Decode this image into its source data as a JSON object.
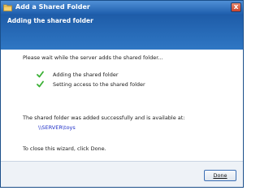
{
  "window": {
    "title": "Add a Shared Folder",
    "close_label": "x"
  },
  "banner": {
    "title": "Adding the shared folder"
  },
  "main": {
    "wait_message": "Please wait while the server adds the shared folder...",
    "steps": [
      {
        "label": "Adding the shared folder",
        "status": "complete",
        "icon": "checkmark-icon"
      },
      {
        "label": "Setting access to the shared folder",
        "status": "complete",
        "icon": "checkmark-icon"
      }
    ],
    "success_message": "The shared folder was added successfully and is available at:",
    "folder_path": "\\\\SERVER\\toys",
    "close_instructions": "To close this wizard, click Done."
  },
  "footer": {
    "done_label": "Done"
  },
  "colors": {
    "title_bar": "#2a68b8",
    "banner": "#2f77c4",
    "link": "#2030c8",
    "checkmark": "#3bb035"
  }
}
